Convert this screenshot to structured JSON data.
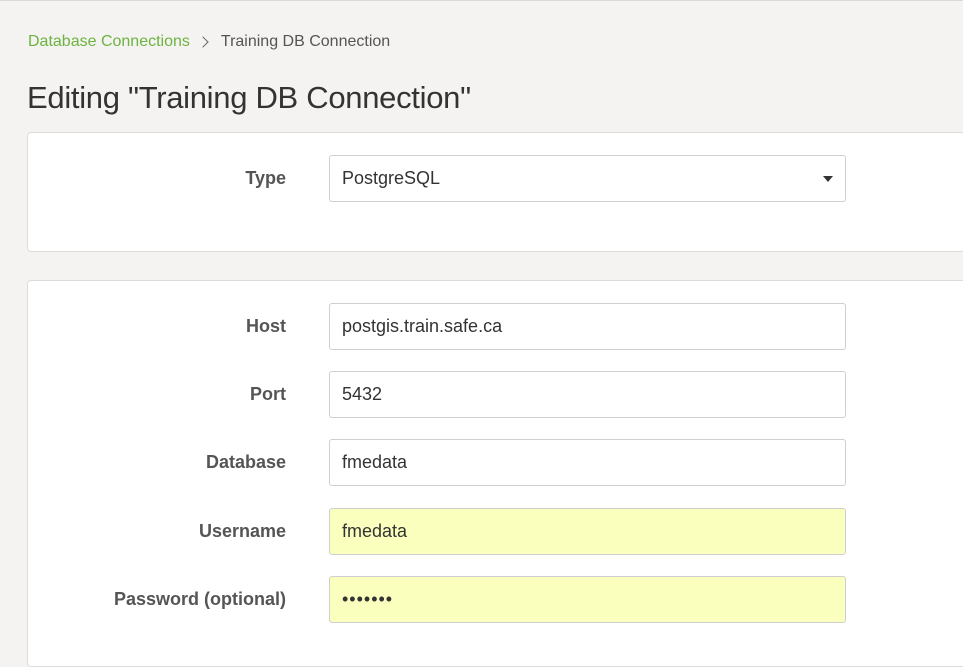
{
  "breadcrumb": {
    "parent": "Database Connections",
    "current": "Training DB Connection"
  },
  "page": {
    "title": "Editing \"Training DB Connection\""
  },
  "type_section": {
    "label": "Type",
    "selected": "PostgreSQL"
  },
  "connection": {
    "host": {
      "label": "Host",
      "value": "postgis.train.safe.ca"
    },
    "port": {
      "label": "Port",
      "value": "5432"
    },
    "database": {
      "label": "Database",
      "value": "fmedata"
    },
    "username": {
      "label": "Username",
      "value": "fmedata"
    },
    "password": {
      "label": "Password (optional)",
      "masked": "•••••••"
    }
  },
  "colors": {
    "link": "#6db33f",
    "autofill": "#faffbd",
    "page_bg": "#f4f3f1"
  }
}
